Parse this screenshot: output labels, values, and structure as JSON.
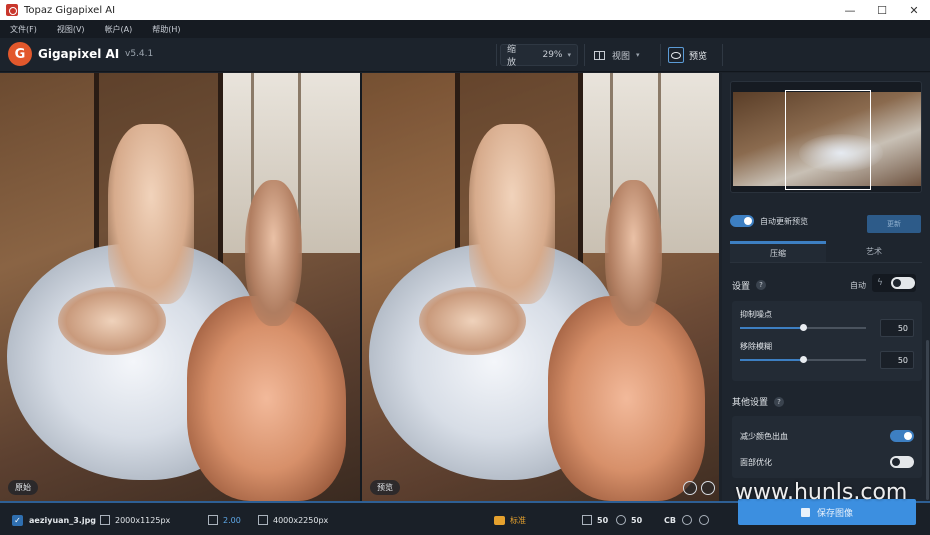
{
  "window": {
    "title": "Topaz Gigapixel AI",
    "controls": {
      "minimize": "—",
      "maximize": "☐",
      "close": "✕"
    }
  },
  "menu": [
    "文件(F)",
    "视图(V)",
    "帐户(A)",
    "帮助(H)"
  ],
  "header": {
    "logo_letter": "G",
    "brand": "Gigapixel AI",
    "version": "v5.4.1",
    "zoom_label": "缩放",
    "zoom_value": "29%",
    "view_label": "视图",
    "preview_label": "预览"
  },
  "panels": {
    "left_tag": "原始",
    "right_tag": "预览"
  },
  "sidebar": {
    "auto_update_label": "自动更新预览",
    "update_button": "更新",
    "tabs": [
      {
        "label": "压缩",
        "active": true
      },
      {
        "label": "艺术",
        "active": false
      }
    ],
    "settings_label": "设置",
    "auto_label": "自动",
    "sliders": [
      {
        "label": "抑制噪点",
        "value": "50",
        "percent": 50
      },
      {
        "label": "移除模糊",
        "value": "50",
        "percent": 50
      }
    ],
    "other_label": "其他设置",
    "other_settings": [
      {
        "label": "减少颜色出血",
        "on": true
      },
      {
        "label": "面部优化",
        "on": false
      }
    ]
  },
  "bottom": {
    "filename": "aeziyuan_3.jpg",
    "source_size": "2000x1125px",
    "scale": "2.00",
    "output_size": "4000x2250px",
    "mode": "标准",
    "noise_value": "50",
    "blur_value": "50",
    "cb_label": "CB",
    "save_label": "保存图像"
  },
  "watermark": "www.hunls.com",
  "colors": {
    "accent": "#3c8fe0",
    "toggle_on": "#3d7fc2",
    "mode": "#e5a12e",
    "background": "#1b2129"
  }
}
